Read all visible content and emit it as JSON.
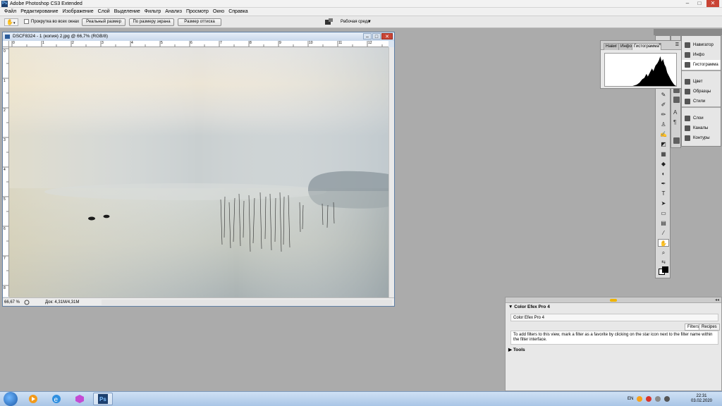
{
  "window": {
    "title": "Adobe Photoshop CS3 Extended",
    "app_icon": "Ps",
    "minimize": "–",
    "maximize": "□",
    "close": "✕"
  },
  "menu": [
    "Файл",
    "Редактирование",
    "Изображение",
    "Слой",
    "Выделение",
    "Фильтр",
    "Анализ",
    "Просмотр",
    "Окно",
    "Справка"
  ],
  "options": {
    "tool_icon": "hand-icon",
    "scroll_all_label": "Прокрутка во всех окнах",
    "actual_pixels": "Реальный размер",
    "fit_screen": "По размеру экрана",
    "print_size": "Размер оттиска",
    "workspace_label": "Рабочая среда",
    "workspace_arrow": "▼"
  },
  "document": {
    "title": "DSCF8324 - 1 (копия) 2.jpg @ 66,7% (RGB/8)",
    "zoom": "66,67 %",
    "doc_info": "Док: 4,31M/4,31M",
    "ruler_h": [
      "0",
      "1",
      "2",
      "3",
      "4",
      "5",
      "6",
      "7",
      "8",
      "9",
      "10",
      "11",
      "12"
    ],
    "ruler_v": [
      "0",
      "1",
      "2",
      "3",
      "4",
      "5",
      "6",
      "7",
      "8"
    ]
  },
  "panels": {
    "group1": [
      "Навигатор",
      "Инфо",
      "Гистограмма"
    ],
    "group2": [
      "Цвет",
      "Образцы",
      "Стили"
    ],
    "group3": [
      "Слои",
      "Каналы",
      "Контуры"
    ],
    "active": "Гистограмма"
  },
  "histogram": {
    "tabs": [
      "Навиг",
      "Инфо",
      "Гистограмма"
    ],
    "close": "×"
  },
  "efex": {
    "header": "Color Efex Pro 4",
    "field": "Color Efex Pro 4",
    "tab_filters": "Filters",
    "tab_recipes": "Recipes",
    "info": "To add filters to this view, mark a filter as a favorite by clicking on the star icon next to the filter name within the filter interface.",
    "tools": "Tools",
    "dock_ctrl": "◂◂"
  },
  "taskbar": {
    "lang": "EN",
    "time": "22:31",
    "date": "03.02.2020",
    "colors": {
      "accent": "#1c5aa8",
      "ps": "#1c3f6e"
    }
  }
}
